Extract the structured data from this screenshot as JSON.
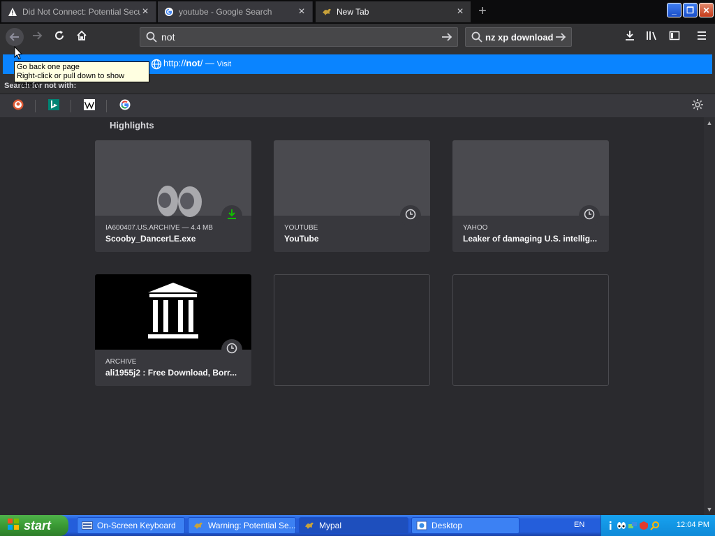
{
  "tabs": [
    {
      "title": "Did Not Connect: Potential Secu",
      "icon": "warning-icon"
    },
    {
      "title": "youtube - Google Search",
      "icon": "google-icon"
    },
    {
      "title": "New Tab",
      "icon": "mypal-icon"
    }
  ],
  "urlbar": {
    "value": "not"
  },
  "searchbar": {
    "value": "nz xp download"
  },
  "suggestion": {
    "prefix": "http://",
    "host": "not",
    "suffix": "/",
    "separator": " — ",
    "action": "Visit"
  },
  "search_for_label": "Search for not  with:",
  "tooltip": {
    "line1": "Go back one page",
    "line2": "Right-click or pull down to show history"
  },
  "highlights": {
    "title": "Highlights",
    "cards": [
      {
        "source": "IA600407.US.ARCHIVE — 4.4 MB",
        "title": "Scooby_DancerLE.exe",
        "badge": "download-icon"
      },
      {
        "source": "YOUTUBE",
        "title": "YouTube",
        "badge": "clock-icon"
      },
      {
        "source": "YAHOO",
        "title": "Leaker of damaging U.S. intellig...",
        "badge": "clock-icon"
      },
      {
        "source": "ARCHIVE",
        "title": "ali1955j2 : Free Download, Borr...",
        "badge": "clock-icon"
      }
    ]
  },
  "taskbar": {
    "start_label": "start",
    "items": [
      {
        "label": "On-Screen Keyboard"
      },
      {
        "label": "Warning: Potential Se..."
      },
      {
        "label": "Mypal"
      },
      {
        "label": "Desktop"
      }
    ],
    "language": "EN",
    "clock": "12:04 PM"
  },
  "colors": {
    "accent": "#0a84ff",
    "download": "#12bc00",
    "toolbar": "#323234",
    "content_bg": "#2a2a2e"
  }
}
